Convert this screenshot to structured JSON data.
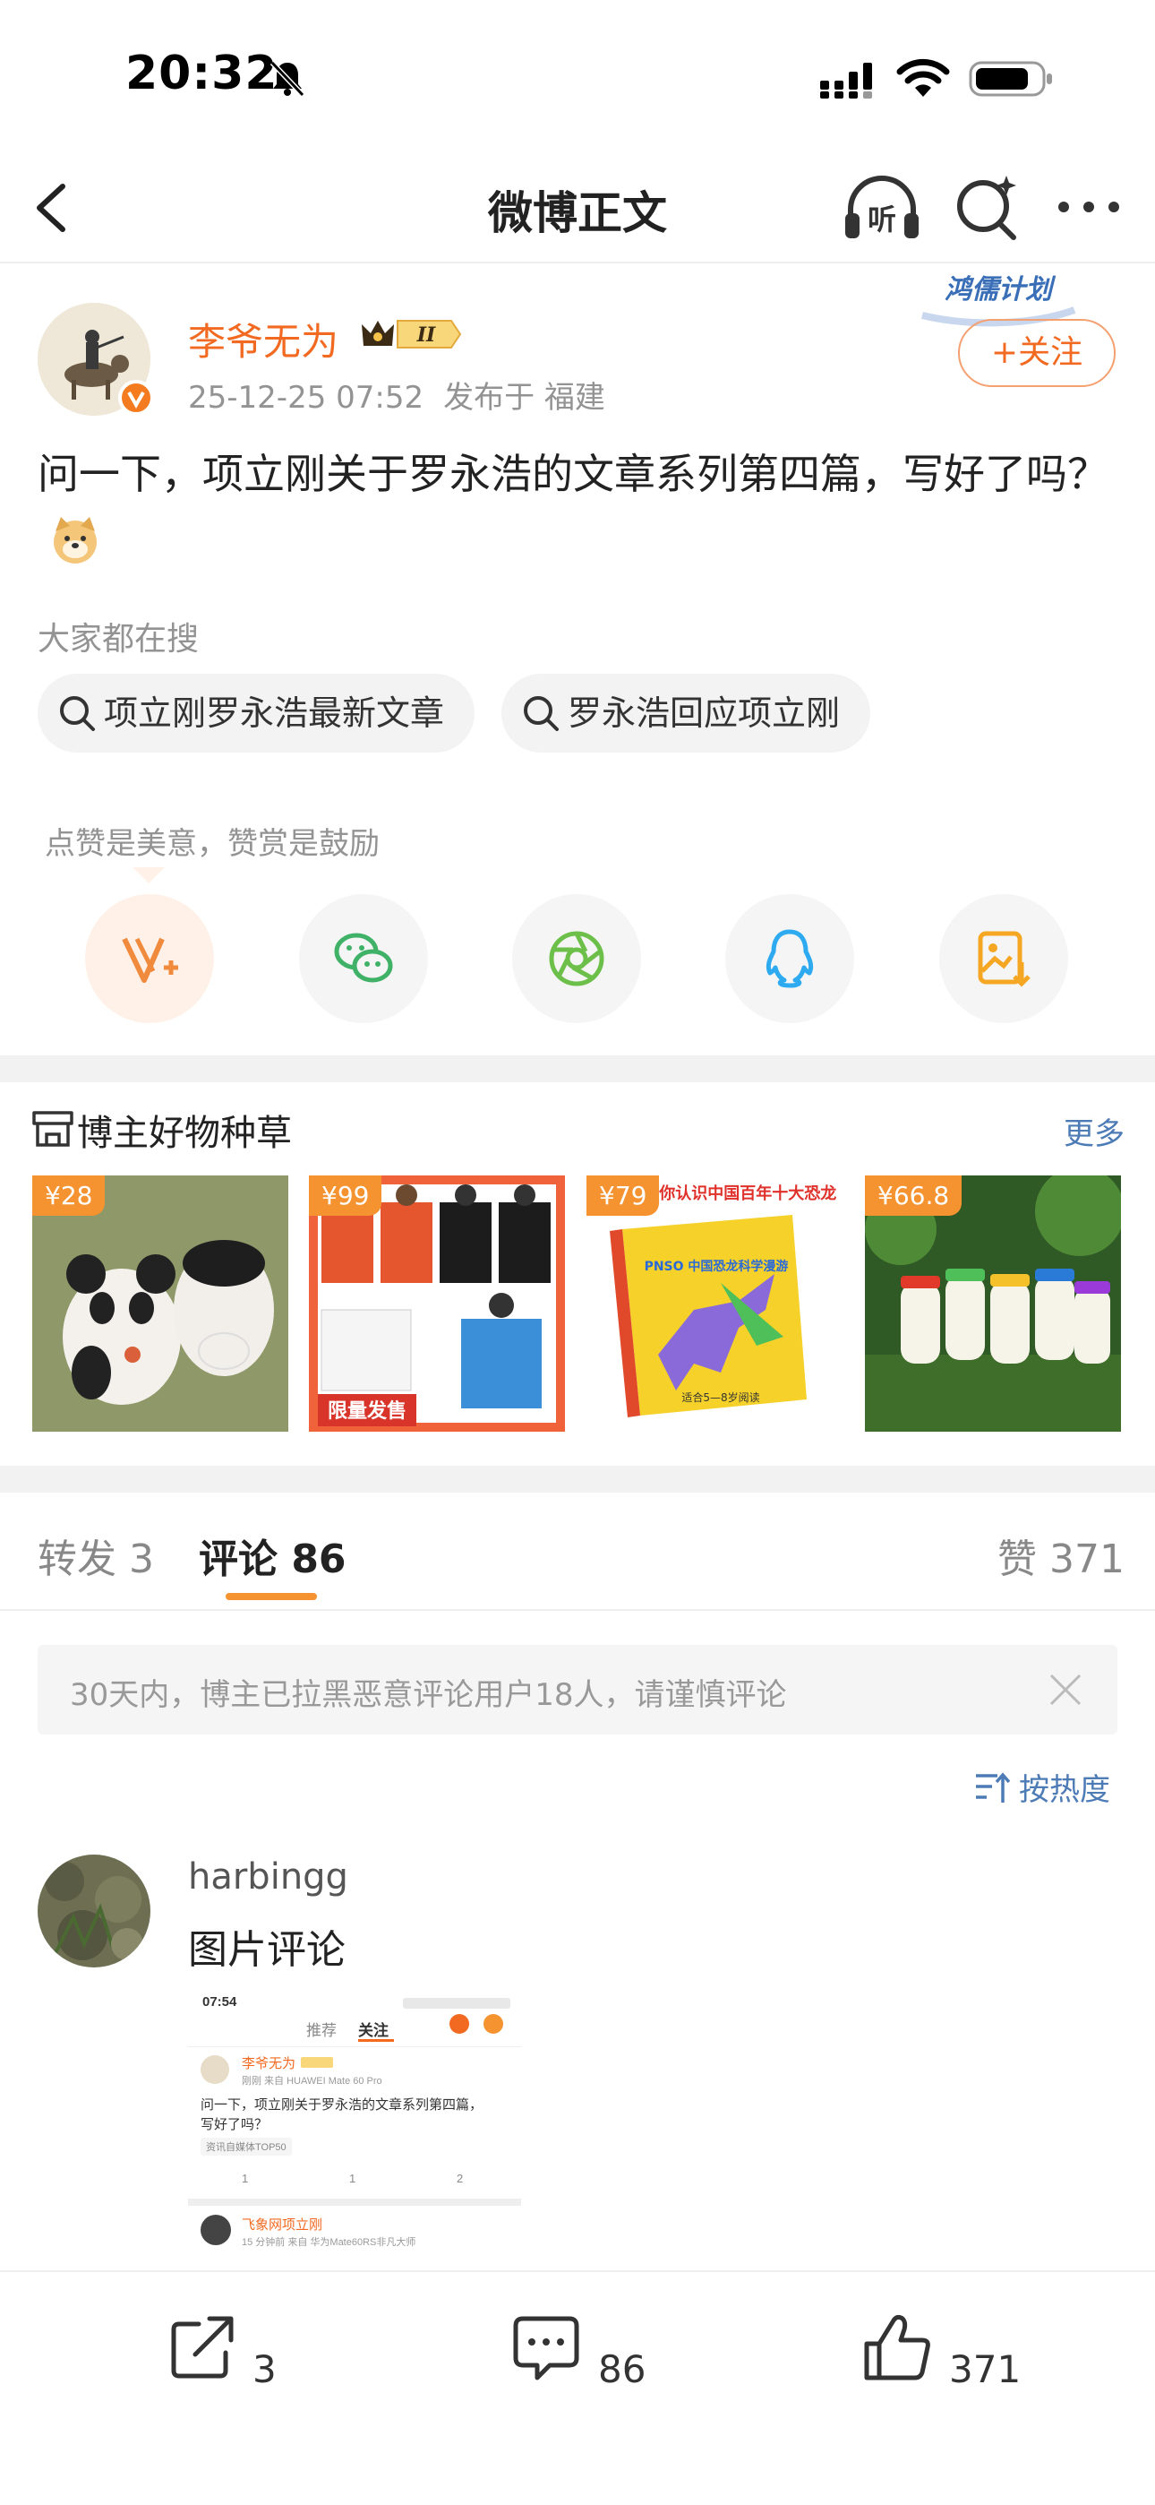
{
  "status_bar": {
    "time": "20:32"
  },
  "nav": {
    "title": "微博正文",
    "listen_label": "听"
  },
  "post": {
    "author": "李爷无为",
    "member_level": "II",
    "date": "25-12-25 07:52",
    "location": "发布于 福建",
    "follow_label": "+关注",
    "badge_text": "鸿儒计划",
    "text": "问一下，项立刚关于罗永浩的文章系列第四篇，写好了吗？"
  },
  "searches": {
    "title": "大家都在搜",
    "items": [
      "项立刚罗永浩最新文章",
      "罗永浩回应项立刚"
    ]
  },
  "reward": {
    "text": "点赞是美意，赞赏是鼓励"
  },
  "goods": {
    "title": "博主好物种草",
    "more": "更多",
    "items": [
      {
        "price": "¥28"
      },
      {
        "price": "¥99",
        "banner": "限量发售"
      },
      {
        "price": "¥79",
        "book_title": "PNSO带你认识中国百年十大恐龙",
        "book_sub": "PNSO 中国恐龙科学漫游",
        "book_age": "适合5—8岁阅读"
      },
      {
        "price": "¥66.8"
      }
    ]
  },
  "tabs": {
    "repost": "转发 3",
    "comments": "评论 86",
    "likes": "赞 371"
  },
  "notice": {
    "text": "30天内，博主已拉黑恶意评论用户18人，请谨慎评论"
  },
  "sort": {
    "label": "按热度"
  },
  "comment": {
    "user": "harbingg",
    "text": "图片评论",
    "image": {
      "time": "07:54",
      "tab_recommend": "推荐",
      "tab_follow": "关注",
      "author": "李爷无为",
      "meta": "刚刚 来自 HUAWEI Mate 60 Pro",
      "text_line1": "问一下，项立刚关于罗永浩的文章系列第四篇，",
      "text_line2": "写好了吗？",
      "tag": "资讯自媒体TOP50",
      "repost_count": "1",
      "comment_count": "1",
      "like_count": "2",
      "next_author": "飞象网项立刚",
      "next_meta": "15 分钟前 来自 华为Mate60RS非凡大师"
    }
  },
  "bottom_bar": {
    "repost_count": "3",
    "comment_count": "86",
    "like_count": "371"
  },
  "colors": {
    "accent": "#f26a21",
    "price": "#f59331",
    "link": "#4d7bb5"
  }
}
